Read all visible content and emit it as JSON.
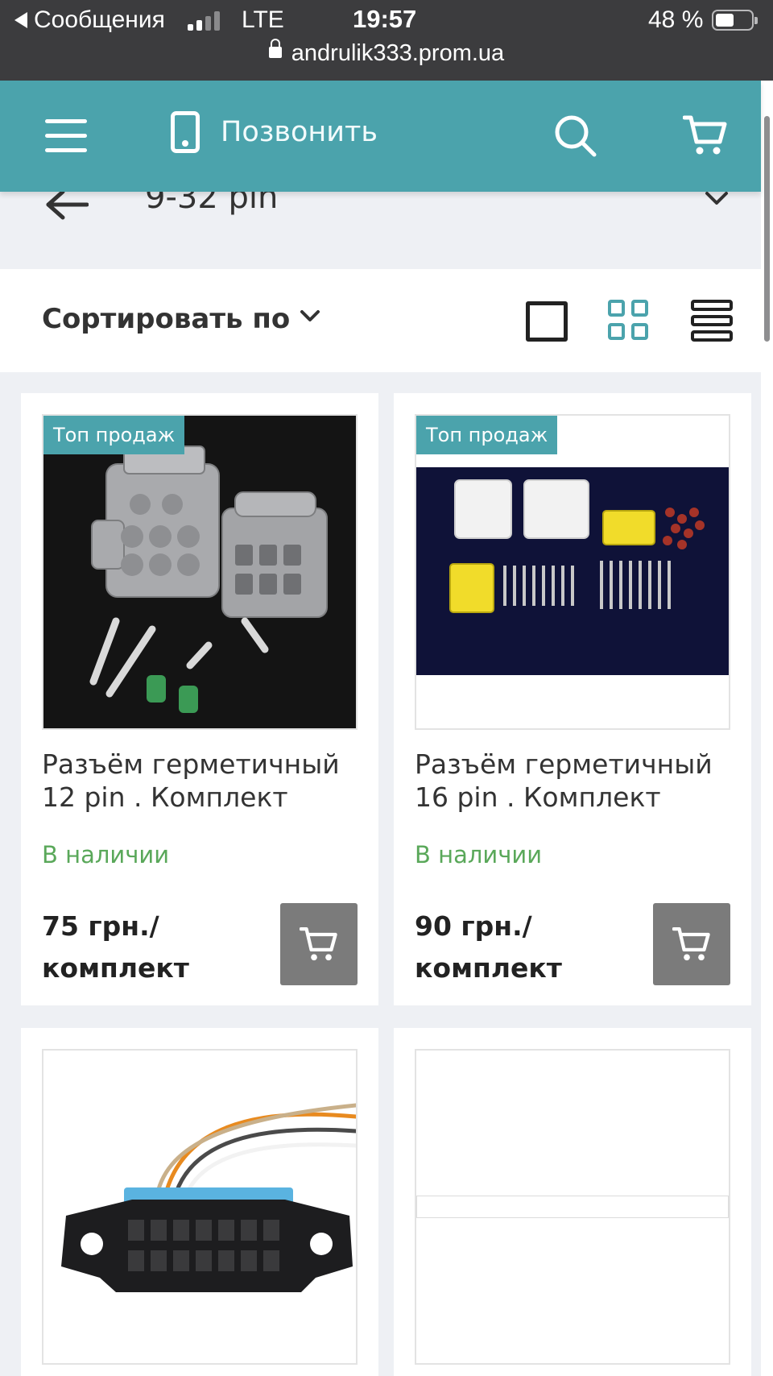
{
  "status_bar": {
    "back_app": "Сообщения",
    "network": "LTE",
    "time": "19:57",
    "battery": "48 %",
    "url": "andrulik333.prom.ua"
  },
  "header": {
    "call_label": "Позвонить",
    "accent_color": "#4ba3ac"
  },
  "category": {
    "title": "9-32 pin"
  },
  "sort": {
    "label": "Сортировать по",
    "active_view": "grid"
  },
  "products": [
    {
      "badge": "Топ продаж",
      "title": "Разъём герметичный 12 pin . Комплект",
      "stock": "В наличии",
      "price_line1": "75 грн./",
      "price_line2": "комплект"
    },
    {
      "badge": "Топ продаж",
      "title": "Разъём герметичный 16 pin . Комплект",
      "stock": "В наличии",
      "price_line1": "90 грн./",
      "price_line2": "комплект"
    }
  ]
}
